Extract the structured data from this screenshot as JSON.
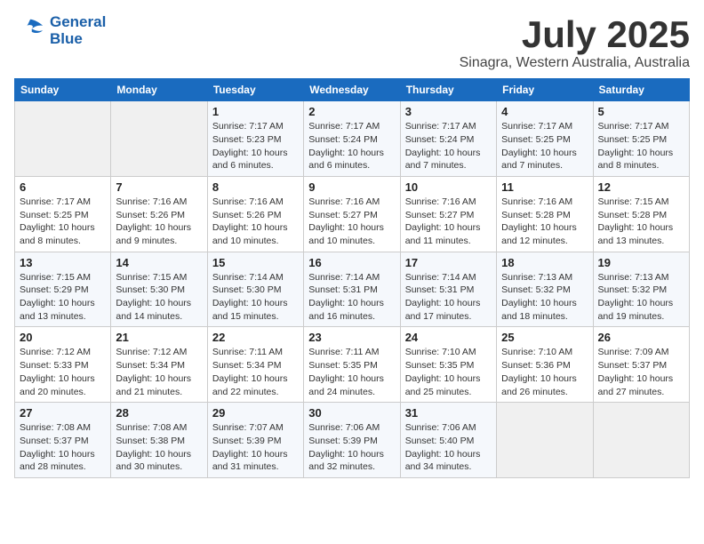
{
  "header": {
    "logo_line1": "General",
    "logo_line2": "Blue",
    "month": "July 2025",
    "location": "Sinagra, Western Australia, Australia"
  },
  "weekdays": [
    "Sunday",
    "Monday",
    "Tuesday",
    "Wednesday",
    "Thursday",
    "Friday",
    "Saturday"
  ],
  "weeks": [
    [
      {
        "day": "",
        "sunrise": "",
        "sunset": "",
        "daylight": ""
      },
      {
        "day": "",
        "sunrise": "",
        "sunset": "",
        "daylight": ""
      },
      {
        "day": "1",
        "sunrise": "Sunrise: 7:17 AM",
        "sunset": "Sunset: 5:23 PM",
        "daylight": "Daylight: 10 hours and 6 minutes."
      },
      {
        "day": "2",
        "sunrise": "Sunrise: 7:17 AM",
        "sunset": "Sunset: 5:24 PM",
        "daylight": "Daylight: 10 hours and 6 minutes."
      },
      {
        "day": "3",
        "sunrise": "Sunrise: 7:17 AM",
        "sunset": "Sunset: 5:24 PM",
        "daylight": "Daylight: 10 hours and 7 minutes."
      },
      {
        "day": "4",
        "sunrise": "Sunrise: 7:17 AM",
        "sunset": "Sunset: 5:25 PM",
        "daylight": "Daylight: 10 hours and 7 minutes."
      },
      {
        "day": "5",
        "sunrise": "Sunrise: 7:17 AM",
        "sunset": "Sunset: 5:25 PM",
        "daylight": "Daylight: 10 hours and 8 minutes."
      }
    ],
    [
      {
        "day": "6",
        "sunrise": "Sunrise: 7:17 AM",
        "sunset": "Sunset: 5:25 PM",
        "daylight": "Daylight: 10 hours and 8 minutes."
      },
      {
        "day": "7",
        "sunrise": "Sunrise: 7:16 AM",
        "sunset": "Sunset: 5:26 PM",
        "daylight": "Daylight: 10 hours and 9 minutes."
      },
      {
        "day": "8",
        "sunrise": "Sunrise: 7:16 AM",
        "sunset": "Sunset: 5:26 PM",
        "daylight": "Daylight: 10 hours and 10 minutes."
      },
      {
        "day": "9",
        "sunrise": "Sunrise: 7:16 AM",
        "sunset": "Sunset: 5:27 PM",
        "daylight": "Daylight: 10 hours and 10 minutes."
      },
      {
        "day": "10",
        "sunrise": "Sunrise: 7:16 AM",
        "sunset": "Sunset: 5:27 PM",
        "daylight": "Daylight: 10 hours and 11 minutes."
      },
      {
        "day": "11",
        "sunrise": "Sunrise: 7:16 AM",
        "sunset": "Sunset: 5:28 PM",
        "daylight": "Daylight: 10 hours and 12 minutes."
      },
      {
        "day": "12",
        "sunrise": "Sunrise: 7:15 AM",
        "sunset": "Sunset: 5:28 PM",
        "daylight": "Daylight: 10 hours and 13 minutes."
      }
    ],
    [
      {
        "day": "13",
        "sunrise": "Sunrise: 7:15 AM",
        "sunset": "Sunset: 5:29 PM",
        "daylight": "Daylight: 10 hours and 13 minutes."
      },
      {
        "day": "14",
        "sunrise": "Sunrise: 7:15 AM",
        "sunset": "Sunset: 5:30 PM",
        "daylight": "Daylight: 10 hours and 14 minutes."
      },
      {
        "day": "15",
        "sunrise": "Sunrise: 7:14 AM",
        "sunset": "Sunset: 5:30 PM",
        "daylight": "Daylight: 10 hours and 15 minutes."
      },
      {
        "day": "16",
        "sunrise": "Sunrise: 7:14 AM",
        "sunset": "Sunset: 5:31 PM",
        "daylight": "Daylight: 10 hours and 16 minutes."
      },
      {
        "day": "17",
        "sunrise": "Sunrise: 7:14 AM",
        "sunset": "Sunset: 5:31 PM",
        "daylight": "Daylight: 10 hours and 17 minutes."
      },
      {
        "day": "18",
        "sunrise": "Sunrise: 7:13 AM",
        "sunset": "Sunset: 5:32 PM",
        "daylight": "Daylight: 10 hours and 18 minutes."
      },
      {
        "day": "19",
        "sunrise": "Sunrise: 7:13 AM",
        "sunset": "Sunset: 5:32 PM",
        "daylight": "Daylight: 10 hours and 19 minutes."
      }
    ],
    [
      {
        "day": "20",
        "sunrise": "Sunrise: 7:12 AM",
        "sunset": "Sunset: 5:33 PM",
        "daylight": "Daylight: 10 hours and 20 minutes."
      },
      {
        "day": "21",
        "sunrise": "Sunrise: 7:12 AM",
        "sunset": "Sunset: 5:34 PM",
        "daylight": "Daylight: 10 hours and 21 minutes."
      },
      {
        "day": "22",
        "sunrise": "Sunrise: 7:11 AM",
        "sunset": "Sunset: 5:34 PM",
        "daylight": "Daylight: 10 hours and 22 minutes."
      },
      {
        "day": "23",
        "sunrise": "Sunrise: 7:11 AM",
        "sunset": "Sunset: 5:35 PM",
        "daylight": "Daylight: 10 hours and 24 minutes."
      },
      {
        "day": "24",
        "sunrise": "Sunrise: 7:10 AM",
        "sunset": "Sunset: 5:35 PM",
        "daylight": "Daylight: 10 hours and 25 minutes."
      },
      {
        "day": "25",
        "sunrise": "Sunrise: 7:10 AM",
        "sunset": "Sunset: 5:36 PM",
        "daylight": "Daylight: 10 hours and 26 minutes."
      },
      {
        "day": "26",
        "sunrise": "Sunrise: 7:09 AM",
        "sunset": "Sunset: 5:37 PM",
        "daylight": "Daylight: 10 hours and 27 minutes."
      }
    ],
    [
      {
        "day": "27",
        "sunrise": "Sunrise: 7:08 AM",
        "sunset": "Sunset: 5:37 PM",
        "daylight": "Daylight: 10 hours and 28 minutes."
      },
      {
        "day": "28",
        "sunrise": "Sunrise: 7:08 AM",
        "sunset": "Sunset: 5:38 PM",
        "daylight": "Daylight: 10 hours and 30 minutes."
      },
      {
        "day": "29",
        "sunrise": "Sunrise: 7:07 AM",
        "sunset": "Sunset: 5:39 PM",
        "daylight": "Daylight: 10 hours and 31 minutes."
      },
      {
        "day": "30",
        "sunrise": "Sunrise: 7:06 AM",
        "sunset": "Sunset: 5:39 PM",
        "daylight": "Daylight: 10 hours and 32 minutes."
      },
      {
        "day": "31",
        "sunrise": "Sunrise: 7:06 AM",
        "sunset": "Sunset: 5:40 PM",
        "daylight": "Daylight: 10 hours and 34 minutes."
      },
      {
        "day": "",
        "sunrise": "",
        "sunset": "",
        "daylight": ""
      },
      {
        "day": "",
        "sunrise": "",
        "sunset": "",
        "daylight": ""
      }
    ]
  ]
}
